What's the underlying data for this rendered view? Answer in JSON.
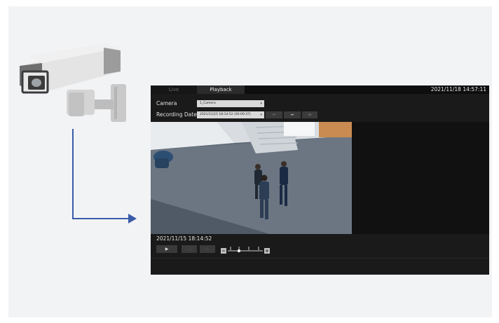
{
  "viewer": {
    "tabs": {
      "live": "Live",
      "playback": "Playback"
    },
    "clock": "2021/11/18 14:57:11",
    "camera_label": "Camera",
    "camera_value": "1_Camera",
    "recording_date_label": "Recording Date",
    "recording_date_value": "2021/11/15 18:14:52 (00:00:37)",
    "timestamp": "2021/11/15 18:14:52"
  },
  "colors": {
    "arrow": "#3a5ba8",
    "viewer_bg": "#1a1a1a"
  }
}
